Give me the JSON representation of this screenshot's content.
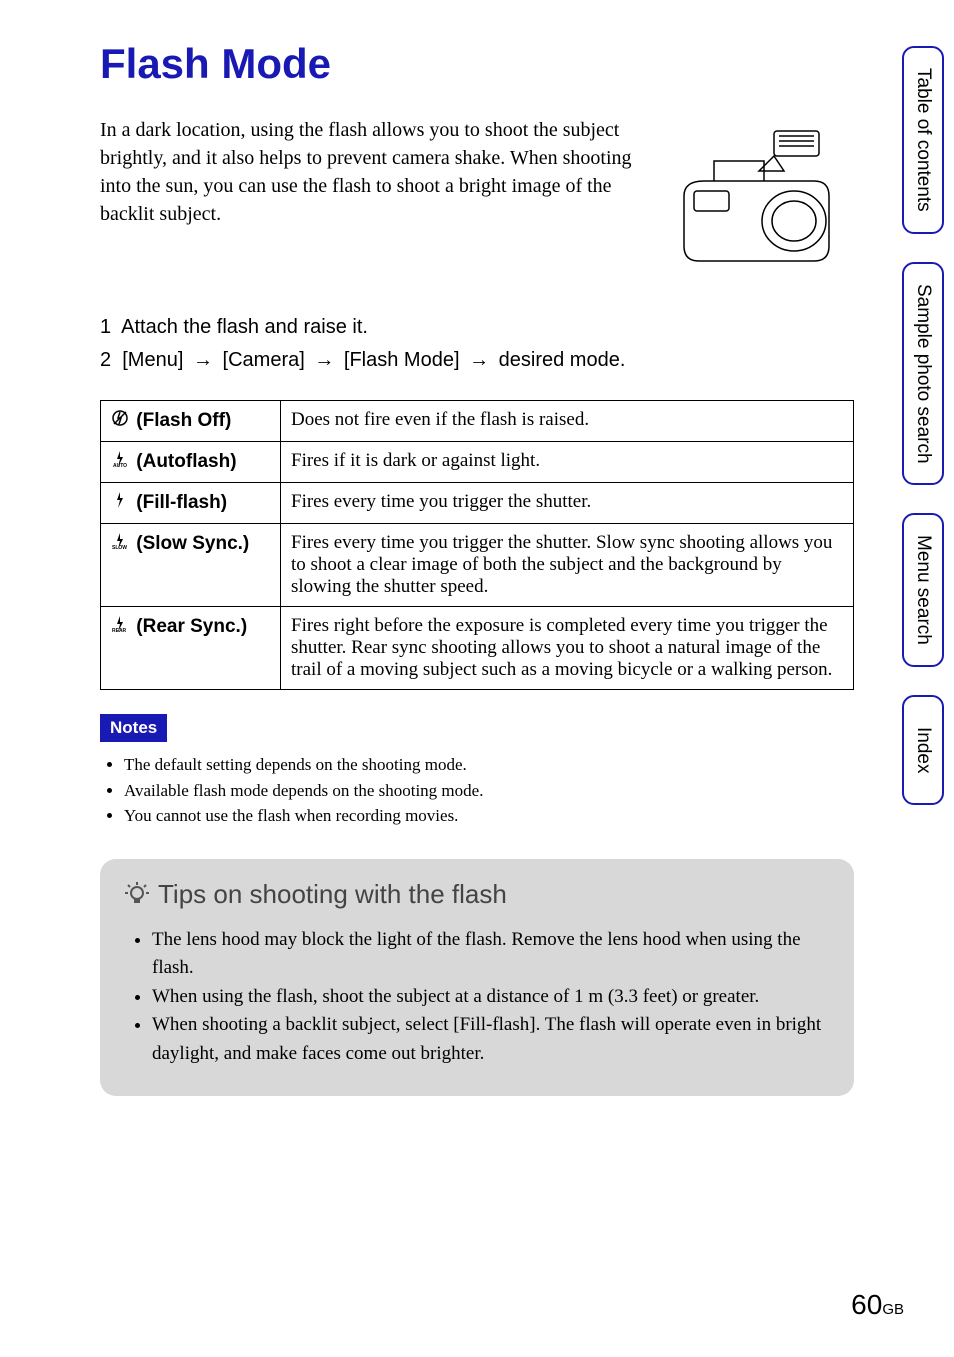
{
  "title": "Flash Mode",
  "intro": "In a dark location, using the flash allows you to shoot the subject brightly, and it also helps to prevent camera shake. When shooting into the sun, you can use the flash to shoot a bright image of the backlit subject.",
  "steps": {
    "step1_num": "1",
    "step1_text": "Attach the flash and raise it.",
    "step2_num": "2",
    "step2_prefix": "[Menu]",
    "step2_mid1": "[Camera]",
    "step2_mid2": "[Flash Mode]",
    "step2_suffix": "desired mode."
  },
  "modes": [
    {
      "icon": "flash-off-icon",
      "label": "(Flash Off)",
      "desc": "Does not fire even if the flash is raised."
    },
    {
      "icon": "autoflash-icon",
      "label": "(Autoflash)",
      "desc": "Fires if it is dark or against light."
    },
    {
      "icon": "fill-flash-icon",
      "label": "(Fill-flash)",
      "desc": "Fires every time you trigger the shutter."
    },
    {
      "icon": "slow-sync-icon",
      "label": "(Slow Sync.)",
      "desc": "Fires every time you trigger the shutter. Slow sync shooting allows you to shoot a clear image of both the subject and the background by slowing the shutter speed."
    },
    {
      "icon": "rear-sync-icon",
      "label": "(Rear Sync.)",
      "desc": "Fires right before the exposure is completed every time you trigger the shutter. Rear sync shooting allows you to shoot a natural image of the trail of a moving subject such as a moving bicycle or a walking person."
    }
  ],
  "notes": {
    "badge": "Notes",
    "items": [
      "The default setting depends on the shooting mode.",
      "Available flash mode depends on the shooting mode.",
      "You cannot use the flash when recording movies."
    ]
  },
  "tips": {
    "title": "Tips on shooting with the flash",
    "items": [
      "The lens hood may block the light of the flash. Remove the lens hood when using the flash.",
      "When using the flash, shoot the subject at a distance of 1 m (3.3 feet) or greater.",
      "When shooting a backlit subject, select [Fill-flash]. The flash will operate even in bright daylight, and make faces come out brighter."
    ]
  },
  "tabs": {
    "toc": "Table of contents",
    "sample": "Sample photo search",
    "menu": "Menu search",
    "index": "Index"
  },
  "page": {
    "num": "60",
    "suffix": "GB"
  }
}
